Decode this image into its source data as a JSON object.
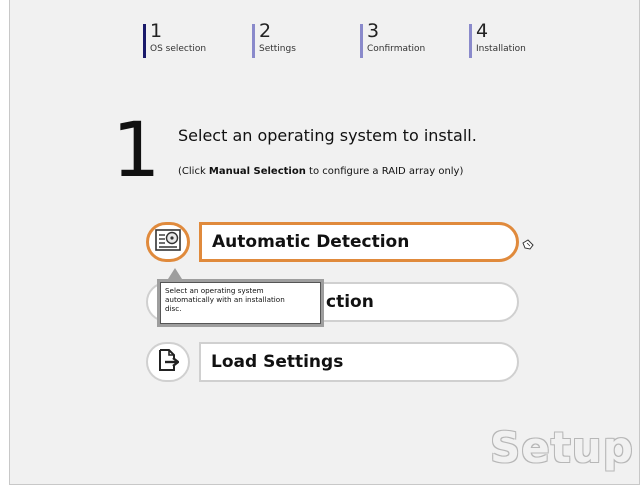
{
  "steps": [
    {
      "number": "1",
      "label": "OS selection",
      "active": true
    },
    {
      "number": "2",
      "label": "Settings",
      "active": false
    },
    {
      "number": "3",
      "label": "Confirmation",
      "active": false
    },
    {
      "number": "4",
      "label": "Installation",
      "active": false
    }
  ],
  "main": {
    "step_number": "1",
    "instruction": "Select an operating system to install.",
    "sub_prefix": "(Click ",
    "sub_bold": "Manual Selection",
    "sub_suffix": " to configure a RAID array only)"
  },
  "options": [
    {
      "label": "Automatic Detection",
      "icon": "disc-drive-icon",
      "highlighted": true
    },
    {
      "label": "Manual Selection",
      "icon": "manual-selection-icon",
      "highlighted": false
    },
    {
      "label": "Load Settings",
      "icon": "load-file-icon",
      "highlighted": false
    }
  ],
  "option2_visible_label": "ction",
  "tooltip": {
    "line1": "Select an operating system",
    "line2": "automatically with an installation",
    "line3": "disc."
  },
  "colors": {
    "highlight": "#e08a3c",
    "step_bar_active": "#1a1a6a",
    "step_bar": "#8a8acb"
  },
  "watermark": "Setup"
}
